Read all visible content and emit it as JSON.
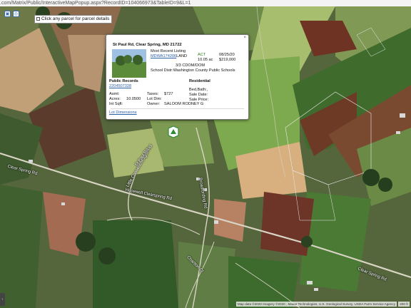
{
  "browser": {
    "url": ".com/Matrix/Public/InteractiveMapPopup.aspx?RecordID=104066973&TableID=9&L=1"
  },
  "map_toolbar": {
    "hint": "Click any parcel for parcel details"
  },
  "popup": {
    "address": "St Paul Rd, Clear Spring, MD 21722",
    "listing_title": "Most Recent Listing",
    "mls_id": "MDWA174206",
    "type": "LAND",
    "status": "ACT",
    "listing_date": "08/25/20",
    "acres": "10.05 ac",
    "price": "$219,000",
    "dom": "3/3 CDOM/DOM",
    "school_label": "School Distr:",
    "school": "Washington County Public Schools",
    "public_records_title": "Public Records",
    "public_records_id": "2204507328",
    "residential_title": "Residential",
    "asmt_label": "Asmt:",
    "acres_label": "Acres:",
    "acres_value": "10.0500",
    "sqft_label": "Int Sqft:",
    "taxes_label": "Taxes:",
    "taxes_value": "$727",
    "lot_dim_label": "Lot Dim:",
    "owner_label": "Owner:",
    "owner_value": "SALOOM RODNEY G",
    "bed_bath_label": "Bed,Bath:",
    "bed_bath_value": ",",
    "sale_date_label": "Sale Date:",
    "sale_price_label": "Sale Price:",
    "lot_dimensions_link": "Lot Dimensions",
    "close": "×"
  },
  "roads": {
    "clear_spring_road_west": "Clear Spring Rd",
    "clear_spring_road_mid": "Hopewell Clearspring Rd",
    "clear_spring_road_east": "Clear Spring Rd",
    "loop": "Little Conococheague Rd",
    "north_south": "Broadfording Rd",
    "small": "St Paul Rd",
    "charlton": "Charlton Ct"
  },
  "attribution": "Map data ©2020 Imagery ©2020 , Maxar Technologies, U.S. Geological Survey, USDA Farm Service Agency",
  "scale": "200 ft",
  "colors": {
    "link": "#2a5fa8",
    "status_green": "#2f7d1d",
    "pin": "#2e8b3a"
  }
}
